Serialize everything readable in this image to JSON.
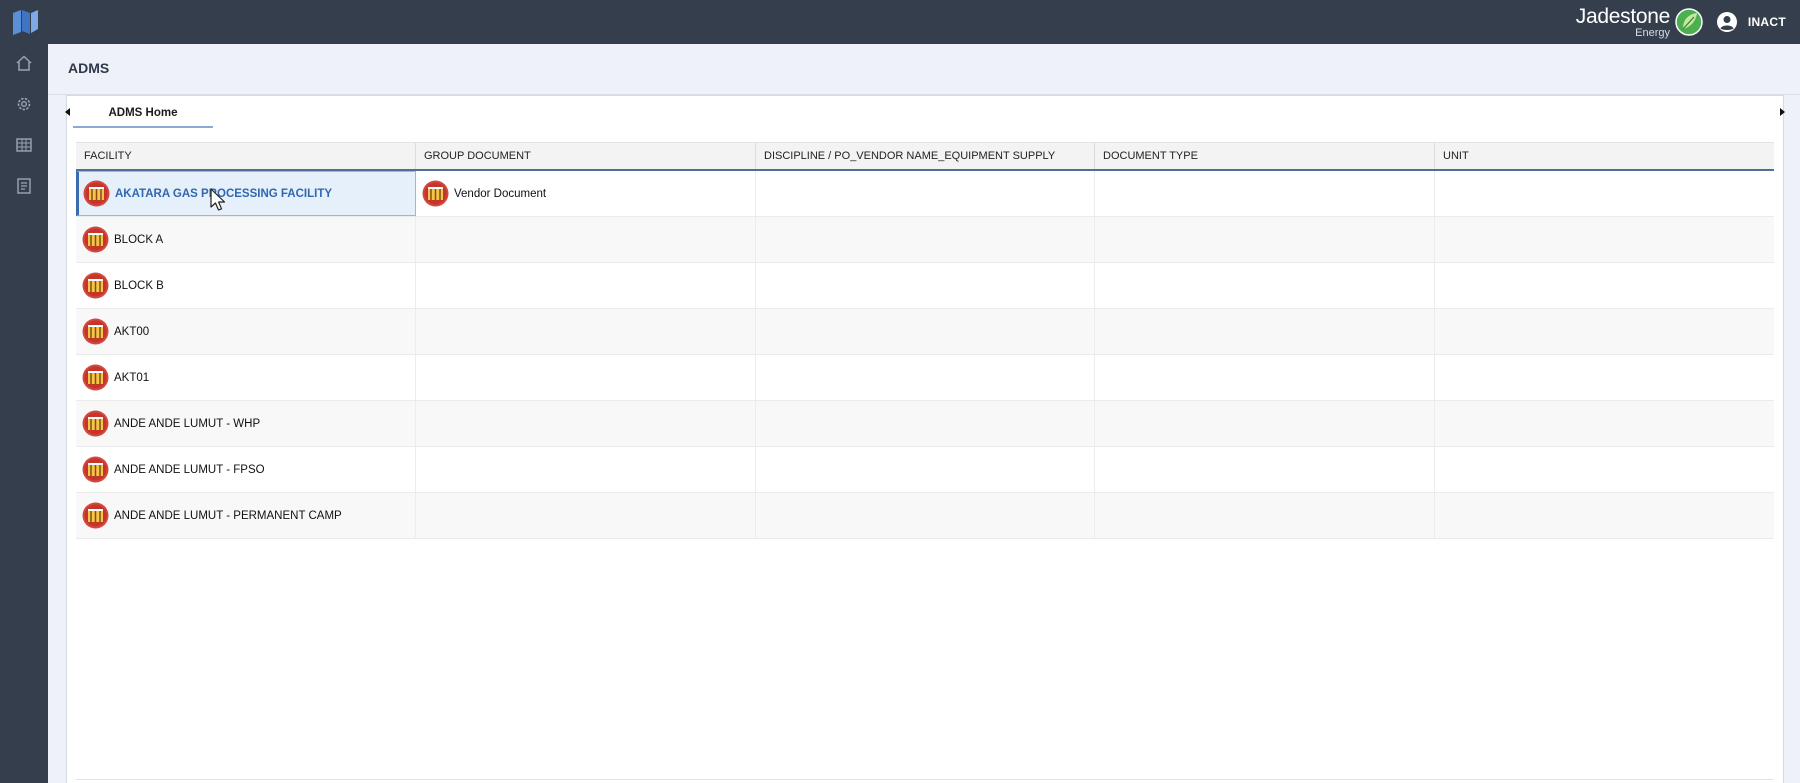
{
  "app": {
    "brand_name": "Jadestone",
    "brand_sub": "Energy",
    "user_name": "INACT",
    "accent": "#3b6cb0",
    "topbar_color": "#353e4c"
  },
  "sidebar": {
    "items": [
      {
        "icon": "home-icon"
      },
      {
        "icon": "gear-icon"
      },
      {
        "icon": "grid-icon"
      },
      {
        "icon": "document-icon"
      }
    ]
  },
  "page": {
    "title": "ADMS"
  },
  "tabs": [
    {
      "label": "ADMS Home",
      "active": true
    }
  ],
  "table": {
    "columns": [
      "FACILITY",
      "GROUP DOCUMENT",
      "DISCIPLINE / PO_VENDOR NAME_EQUIPMENT SUPPLY",
      "DOCUMENT TYPE",
      "UNIT"
    ],
    "rows": [
      {
        "facility": "AKATARA GAS PROCESSING FACILITY",
        "group_document": "Vendor Document",
        "selected": true
      },
      {
        "facility": "BLOCK A",
        "group_document": ""
      },
      {
        "facility": "BLOCK B",
        "group_document": ""
      },
      {
        "facility": "AKT00",
        "group_document": ""
      },
      {
        "facility": "AKT01",
        "group_document": ""
      },
      {
        "facility": "ANDE ANDE LUMUT - WHP",
        "group_document": ""
      },
      {
        "facility": "ANDE ANDE LUMUT - FPSO",
        "group_document": ""
      },
      {
        "facility": "ANDE ANDE LUMUT - PERMANENT CAMP",
        "group_document": ""
      }
    ]
  }
}
